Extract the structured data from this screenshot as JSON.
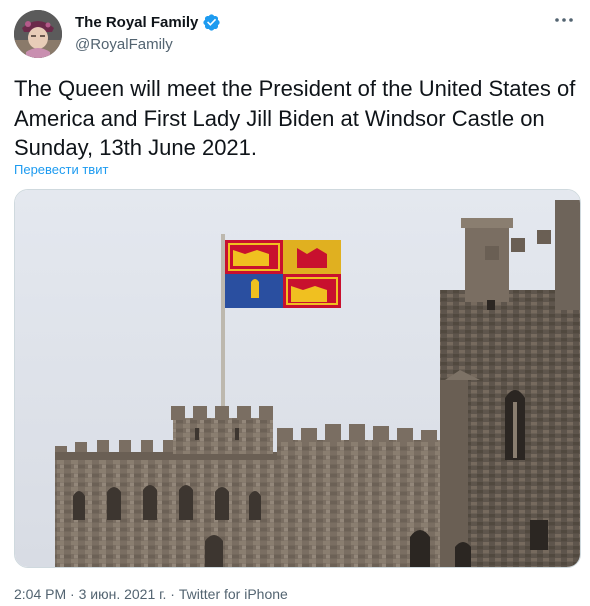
{
  "author": {
    "display_name": "The Royal Family",
    "handle": "@RoyalFamily",
    "verified_icon": "verified-badge-icon",
    "avatar_icon": "avatar-queen-photo"
  },
  "menu": {
    "more_icon": "more-dots-icon"
  },
  "tweet": {
    "text": "The Queen will meet the President of the United States of America and First Lady Jill Biden at Windsor Castle on Sunday, 13th June 2021.",
    "translate_label": "Перевести твит",
    "image_subject": "windsor-castle-royal-standard-photo"
  },
  "meta": {
    "time": "2:04 PM",
    "separator": " · ",
    "date": "3 июн. 2021 г.",
    "source": "Twitter for iPhone"
  },
  "colors": {
    "accent": "#1d9bf0",
    "secondary_text": "#536471",
    "primary_text": "#0f1419",
    "border": "#cfd9de"
  }
}
